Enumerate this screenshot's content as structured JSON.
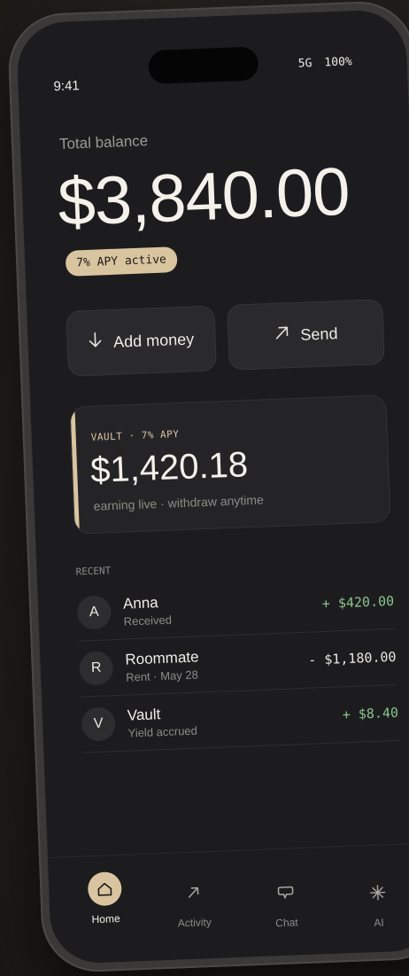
{
  "status_bar": {
    "time": "9:41",
    "network": "5G",
    "battery": "100%"
  },
  "balance": {
    "label": "Total balance",
    "amount": "$3,840.00",
    "badge": "7% APY active"
  },
  "actions": {
    "add_label": "Add money",
    "add_icon": "arrow-down-icon",
    "send_label": "Send",
    "send_icon": "arrow-up-right-icon"
  },
  "vault": {
    "label": "VAULT · 7% APY",
    "amount": "$1,420.18",
    "subtitle": "earning live · withdraw anytime",
    "accent_color": "#d9c4a0"
  },
  "recent": {
    "label": "RECENT",
    "transactions": [
      {
        "initial": "A",
        "name": "Anna",
        "detail": "Received",
        "amount": "+ $420.00",
        "direction": "in"
      },
      {
        "initial": "R",
        "name": "Roommate",
        "detail": "Rent · May 28",
        "amount": "- $1,180.00",
        "direction": "out"
      },
      {
        "initial": "V",
        "name": "Vault",
        "detail": "Yield accrued",
        "amount": "+ $8.40",
        "direction": "in"
      }
    ]
  },
  "tabs": [
    {
      "label": "Home",
      "icon": "home-icon",
      "active": true
    },
    {
      "label": "Activity",
      "icon": "arrow-up-right-icon",
      "active": false
    },
    {
      "label": "Chat",
      "icon": "chat-bubble-icon",
      "active": false
    },
    {
      "label": "AI",
      "icon": "sparkle-icon",
      "active": false
    }
  ],
  "colors": {
    "accent": "#d9c4a0",
    "positive": "#8cc48e",
    "background": "#1c1c1e"
  }
}
